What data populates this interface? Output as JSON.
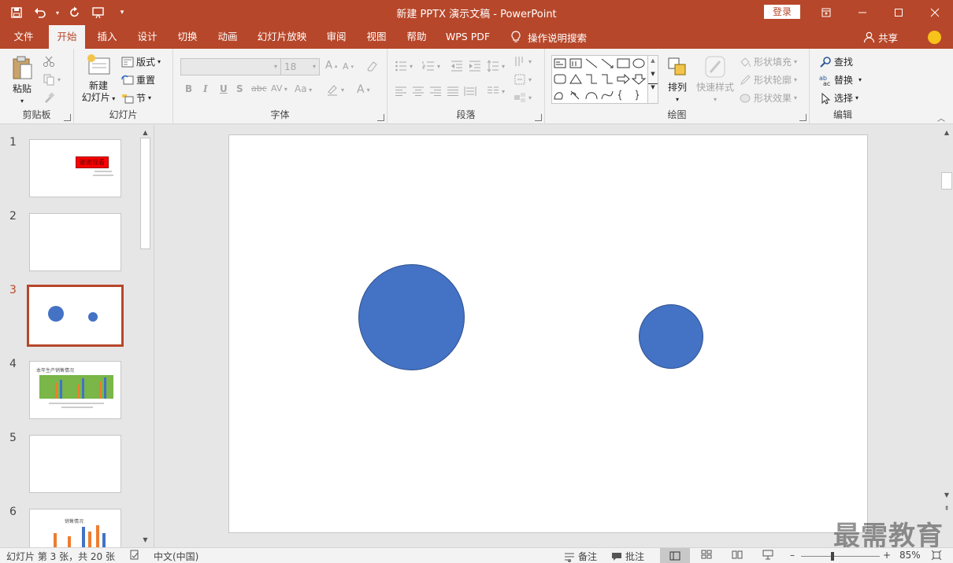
{
  "title": "新建 PPTX 演示文稿  -  PowerPoint",
  "login": "登录",
  "tabs": [
    "文件",
    "开始",
    "插入",
    "设计",
    "切换",
    "动画",
    "幻灯片放映",
    "审阅",
    "视图",
    "帮助",
    "WPS PDF"
  ],
  "active_tab": "开始",
  "search_tell": "操作说明搜索",
  "share": "共享",
  "ribbon": {
    "clipboard": {
      "label": "剪贴板",
      "paste": "粘贴"
    },
    "slides": {
      "label": "幻灯片",
      "new_slide_l1": "新建",
      "new_slide_l2": "幻灯片",
      "layout": "版式",
      "reset": "重置",
      "section": "节"
    },
    "font": {
      "label": "字体",
      "font_size": "18",
      "bold": "B",
      "italic": "I",
      "underline": "U",
      "shadow": "S",
      "strike": "abc",
      "spacing": "AV",
      "case": "Aa"
    },
    "paragraph": {
      "label": "段落"
    },
    "drawing": {
      "label": "绘图",
      "arrange": "排列",
      "quick_styles": "快速样式",
      "shape_fill": "形状填充",
      "shape_outline": "形状轮廓",
      "shape_effects": "形状效果"
    },
    "editing": {
      "label": "编辑",
      "find": "查找",
      "replace": "替换",
      "select": "选择"
    }
  },
  "slides": [
    {
      "num": "1",
      "title_text": "谢谢观看"
    },
    {
      "num": "2"
    },
    {
      "num": "3"
    },
    {
      "num": "4",
      "title_text": "本年生产销售情况"
    },
    {
      "num": "5"
    },
    {
      "num": "6",
      "title_text": "销售情况"
    }
  ],
  "active_slide": "3",
  "status": {
    "slide_info": "幻灯片 第 3 张，共 20 张",
    "language": "中文(中国)",
    "notes": "备注",
    "comments": "批注",
    "zoom": "85%"
  },
  "watermark": "最需教育",
  "colors": {
    "accent": "#b7472a",
    "shape_fill": "#4472c4"
  }
}
